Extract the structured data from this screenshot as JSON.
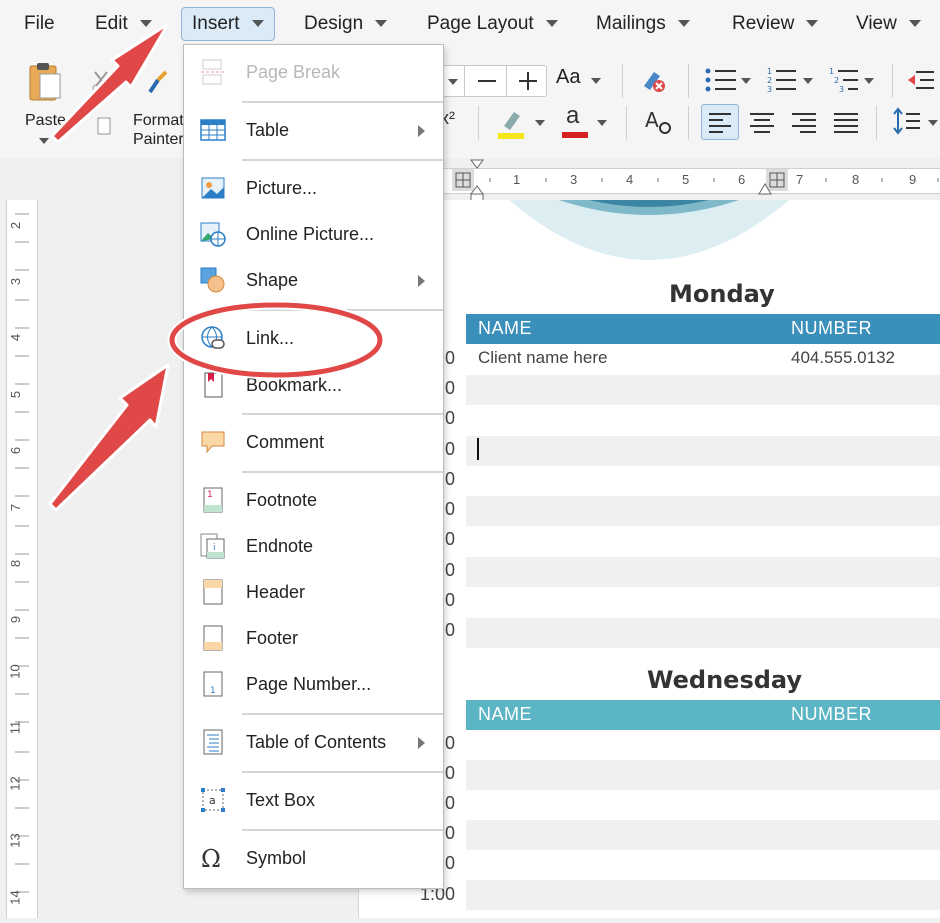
{
  "menubar": {
    "items": [
      {
        "label": "File"
      },
      {
        "label": "Edit"
      },
      {
        "label": "Insert"
      },
      {
        "label": "Design"
      },
      {
        "label": "Page Layout"
      },
      {
        "label": "Mailings"
      },
      {
        "label": "Review"
      },
      {
        "label": "View"
      }
    ]
  },
  "ribbon": {
    "paste_label": "Paste",
    "format_painter_line1": "Format",
    "format_painter_line2": "Painter",
    "font_case_label": "Aa",
    "superscript_label": "x²",
    "font_color_label": "a"
  },
  "hruler": {
    "numbers": [
      "1",
      "2",
      "3",
      "4",
      "5",
      "6",
      "7",
      "8",
      "9"
    ]
  },
  "vruler": {
    "numbers": [
      "2",
      "3",
      "4",
      "5",
      "6",
      "7",
      "8",
      "9",
      "10",
      "11",
      "12",
      "13",
      "14"
    ]
  },
  "document": {
    "monday": {
      "title": "Monday",
      "col_name": "NAME",
      "col_number": "NUMBER",
      "first_row_name": "Client name here",
      "first_row_number": "404.555.0132"
    },
    "wednesday": {
      "title": "Wednesday",
      "col_name": "NAME",
      "col_number": "NUMBER"
    },
    "times_partial": ":0",
    "last_time": "1:00"
  },
  "insert_menu": {
    "items": {
      "page_break": "Page Break",
      "table": "Table",
      "picture": "Picture...",
      "online_picture": "Online Picture...",
      "shape": "Shape",
      "link": "Link...",
      "bookmark": "Bookmark...",
      "comment": "Comment",
      "footnote": "Footnote",
      "endnote": "Endnote",
      "header": "Header",
      "footer": "Footer",
      "page_number": "Page Number...",
      "table_of_contents": "Table of Contents",
      "text_box": "Text Box",
      "symbol": "Symbol"
    }
  },
  "colors": {
    "monday_header": "#3a8fbb",
    "wednesday_header": "#5bb5c5",
    "annotation_red": "#e04848",
    "menu_highlight": "#dbeaf7"
  }
}
